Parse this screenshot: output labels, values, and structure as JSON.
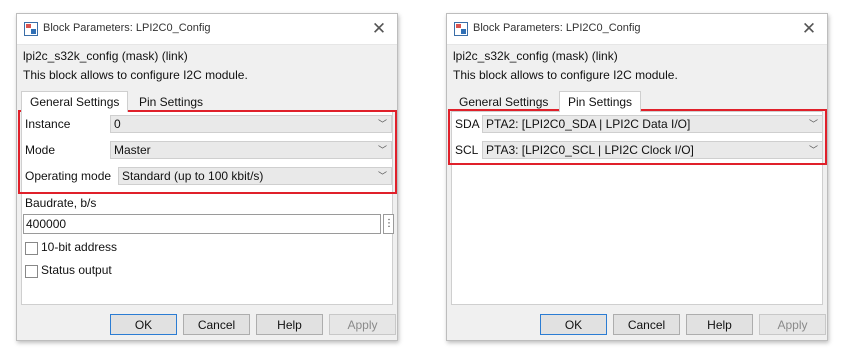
{
  "dialogs": [
    {
      "title": "Block Parameters: LPI2C0_Config",
      "description_line1": "lpi2c_s32k_config (mask) (link)",
      "description_line2": "This block allows to configure I2C module.",
      "tabs": [
        "General Settings",
        "Pin Settings"
      ],
      "active_tab": "General Settings",
      "fields": {
        "instance": {
          "label": "Instance",
          "value": "0"
        },
        "mode": {
          "label": "Mode",
          "value": "Master"
        },
        "operating_mode": {
          "label": "Operating mode",
          "value": "Standard (up to 100 kbit/s)"
        },
        "baudrate": {
          "label": "Baudrate, b/s",
          "value": "400000"
        },
        "ten_bit": {
          "label": "10-bit address",
          "checked": false
        },
        "status_output": {
          "label": "Status output",
          "checked": false
        }
      },
      "buttons": {
        "ok": "OK",
        "cancel": "Cancel",
        "help": "Help",
        "apply": "Apply"
      }
    },
    {
      "title": "Block Parameters: LPI2C0_Config",
      "description_line1": "lpi2c_s32k_config (mask) (link)",
      "description_line2": "This block allows to configure I2C module.",
      "tabs": [
        "General Settings",
        "Pin Settings"
      ],
      "active_tab": "Pin Settings",
      "fields": {
        "sda": {
          "label": "SDA",
          "value": "PTA2: [LPI2C0_SDA | LPI2C Data I/O]"
        },
        "scl": {
          "label": "SCL",
          "value": "PTA3: [LPI2C0_SCL | LPI2C Clock I/O]"
        }
      },
      "buttons": {
        "ok": "OK",
        "cancel": "Cancel",
        "help": "Help",
        "apply": "Apply"
      }
    }
  ],
  "icons": {
    "app": "simulink-block-icon",
    "close": "close-icon",
    "dropdown": "chevron-down-icon",
    "more": "vertical-dots-icon"
  },
  "colors": {
    "highlight": "#e0202a",
    "ok_border": "#2b7cd3"
  }
}
